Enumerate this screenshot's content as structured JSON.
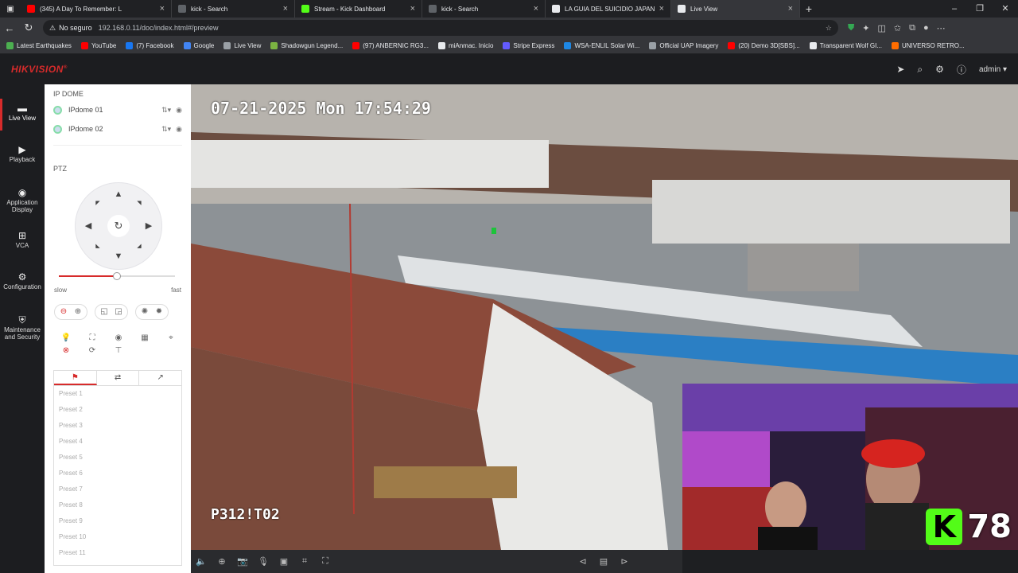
{
  "browser": {
    "tabs": [
      {
        "title": "(345) A Day To Remember: L",
        "color": "#ff0000",
        "width": 190
      },
      {
        "title": "kick - Search",
        "color": "#5f6368",
        "width": 155
      },
      {
        "title": "Stream - Kick Dashboard",
        "color": "#53fc18",
        "width": 160
      },
      {
        "title": "kick - Search",
        "color": "#5f6368",
        "width": 155
      },
      {
        "title": "LA GUIA DEL SUICIDIO JAPAN - E",
        "color": "#e8eaed",
        "width": 158
      },
      {
        "title": "Live View",
        "color": "#e8eaed",
        "width": 162
      }
    ],
    "security_label": "No seguro",
    "url": "192.168.0.11/doc/index.html#/preview",
    "bookmarks": [
      {
        "label": "Latest Earthquakes",
        "color": "#4caf50"
      },
      {
        "label": "YouTube",
        "color": "#ff0000"
      },
      {
        "label": "(7) Facebook",
        "color": "#1877f2"
      },
      {
        "label": "Google",
        "color": "#4285f4"
      },
      {
        "label": "Live View",
        "color": "#9aa0a6"
      },
      {
        "label": "Shadowgun Legend...",
        "color": "#7cb342"
      },
      {
        "label": "(97) ANBERNIC RG3...",
        "color": "#ff0000"
      },
      {
        "label": "miAnmac. Inicio",
        "color": "#e8eaed"
      },
      {
        "label": "Stripe Express",
        "color": "#635bff"
      },
      {
        "label": "WSA-ENLIL Solar Wi...",
        "color": "#1e88e5"
      },
      {
        "label": "Official UAP Imagery",
        "color": "#9aa0a6"
      },
      {
        "label": "(20) Demo 3D[SBS]...",
        "color": "#ff0000"
      },
      {
        "label": "Transparent Wolf GI...",
        "color": "#e8eaed"
      },
      {
        "label": "UNIVERSO RETRO...",
        "color": "#ff6d00"
      }
    ]
  },
  "app": {
    "brand": "HIKVISION",
    "brand_mark": "®",
    "user": "admin",
    "nav": [
      {
        "label": "Live View",
        "icon": "monitor-icon",
        "glyph": "▬"
      },
      {
        "label": "Playback",
        "icon": "playback-icon",
        "glyph": "▶"
      },
      {
        "label": "Application Display",
        "icon": "app-display-icon",
        "glyph": "◉"
      },
      {
        "label": "VCA",
        "icon": "vca-icon",
        "glyph": "⊞"
      },
      {
        "label": "Configuration",
        "icon": "gear-icon",
        "glyph": "⚙"
      },
      {
        "label": "Maintenance and Security",
        "icon": "maintenance-icon",
        "glyph": "⛨"
      }
    ]
  },
  "panel": {
    "section_cameras": "IP DOME",
    "cameras": [
      {
        "label": "IPdome 01"
      },
      {
        "label": "IPdome 02"
      }
    ],
    "section_ptz": "PTZ",
    "speed_min": "slow",
    "speed_max": "fast",
    "speed_value": 0.5,
    "presets": [
      "Preset 1",
      "Preset 2",
      "Preset 3",
      "Preset 4",
      "Preset 5",
      "Preset 6",
      "Preset 7",
      "Preset 8",
      "Preset 9",
      "Preset 10",
      "Preset 11"
    ]
  },
  "video": {
    "timestamp": "07-21-2025 Mon 17:54:29",
    "camera_label": "P312!T02",
    "viewer_count": "78",
    "kick_letter": "K"
  }
}
